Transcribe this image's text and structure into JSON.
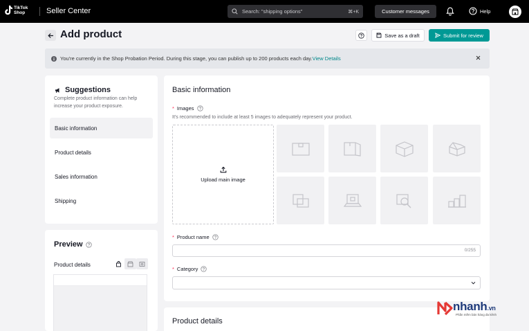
{
  "topbar": {
    "logo_text_line1": "TikTok",
    "logo_text_line2": "Shop",
    "app_title": "Seller Center",
    "search_placeholder": "Search: \"shipping options\"",
    "search_shortcut": "⌘+K",
    "customer_messages": "Customer messages",
    "help_label": "Help"
  },
  "header": {
    "title": "Add product",
    "save_draft": "Save as a draft",
    "submit": "Submit for review"
  },
  "banner": {
    "text": "You're currently in the Shop Probation Period. During this stage, you can publish up to 200 products each day.",
    "link": "View Details"
  },
  "suggestions": {
    "title": "Suggestions",
    "description": "Complete product information can help increase your product exposure.",
    "items": [
      {
        "label": "Basic information",
        "active": true
      },
      {
        "label": "Product details",
        "active": false
      },
      {
        "label": "Sales information",
        "active": false
      },
      {
        "label": "Shipping",
        "active": false
      }
    ]
  },
  "preview": {
    "title": "Preview",
    "product_details_label": "Product details"
  },
  "basic_info": {
    "title": "Basic information",
    "images_label": "Images",
    "images_hint": "It's recommended to include at least 5 images to adequately represent your product.",
    "upload_label": "Upload main image",
    "thumbnails": [
      "box-front-icon",
      "box-side-icon",
      "box-angled-icon",
      "box-open-icon",
      "product-in-use-icon",
      "laptop-box-icon",
      "detail-zoom-icon",
      "size-comparison-icon"
    ],
    "product_name_label": "Product name",
    "product_name_value": "",
    "product_name_counter": "0/255",
    "category_label": "Category",
    "category_value": ""
  },
  "product_details": {
    "title": "Product details"
  },
  "watermark": {
    "brand": "nhanh",
    "suffix": ".vn",
    "tagline": "Phần mềm bán hàng đa kênh"
  },
  "colors": {
    "accent": "#009995",
    "required": "#fe2c55",
    "topbar": "#000000"
  }
}
